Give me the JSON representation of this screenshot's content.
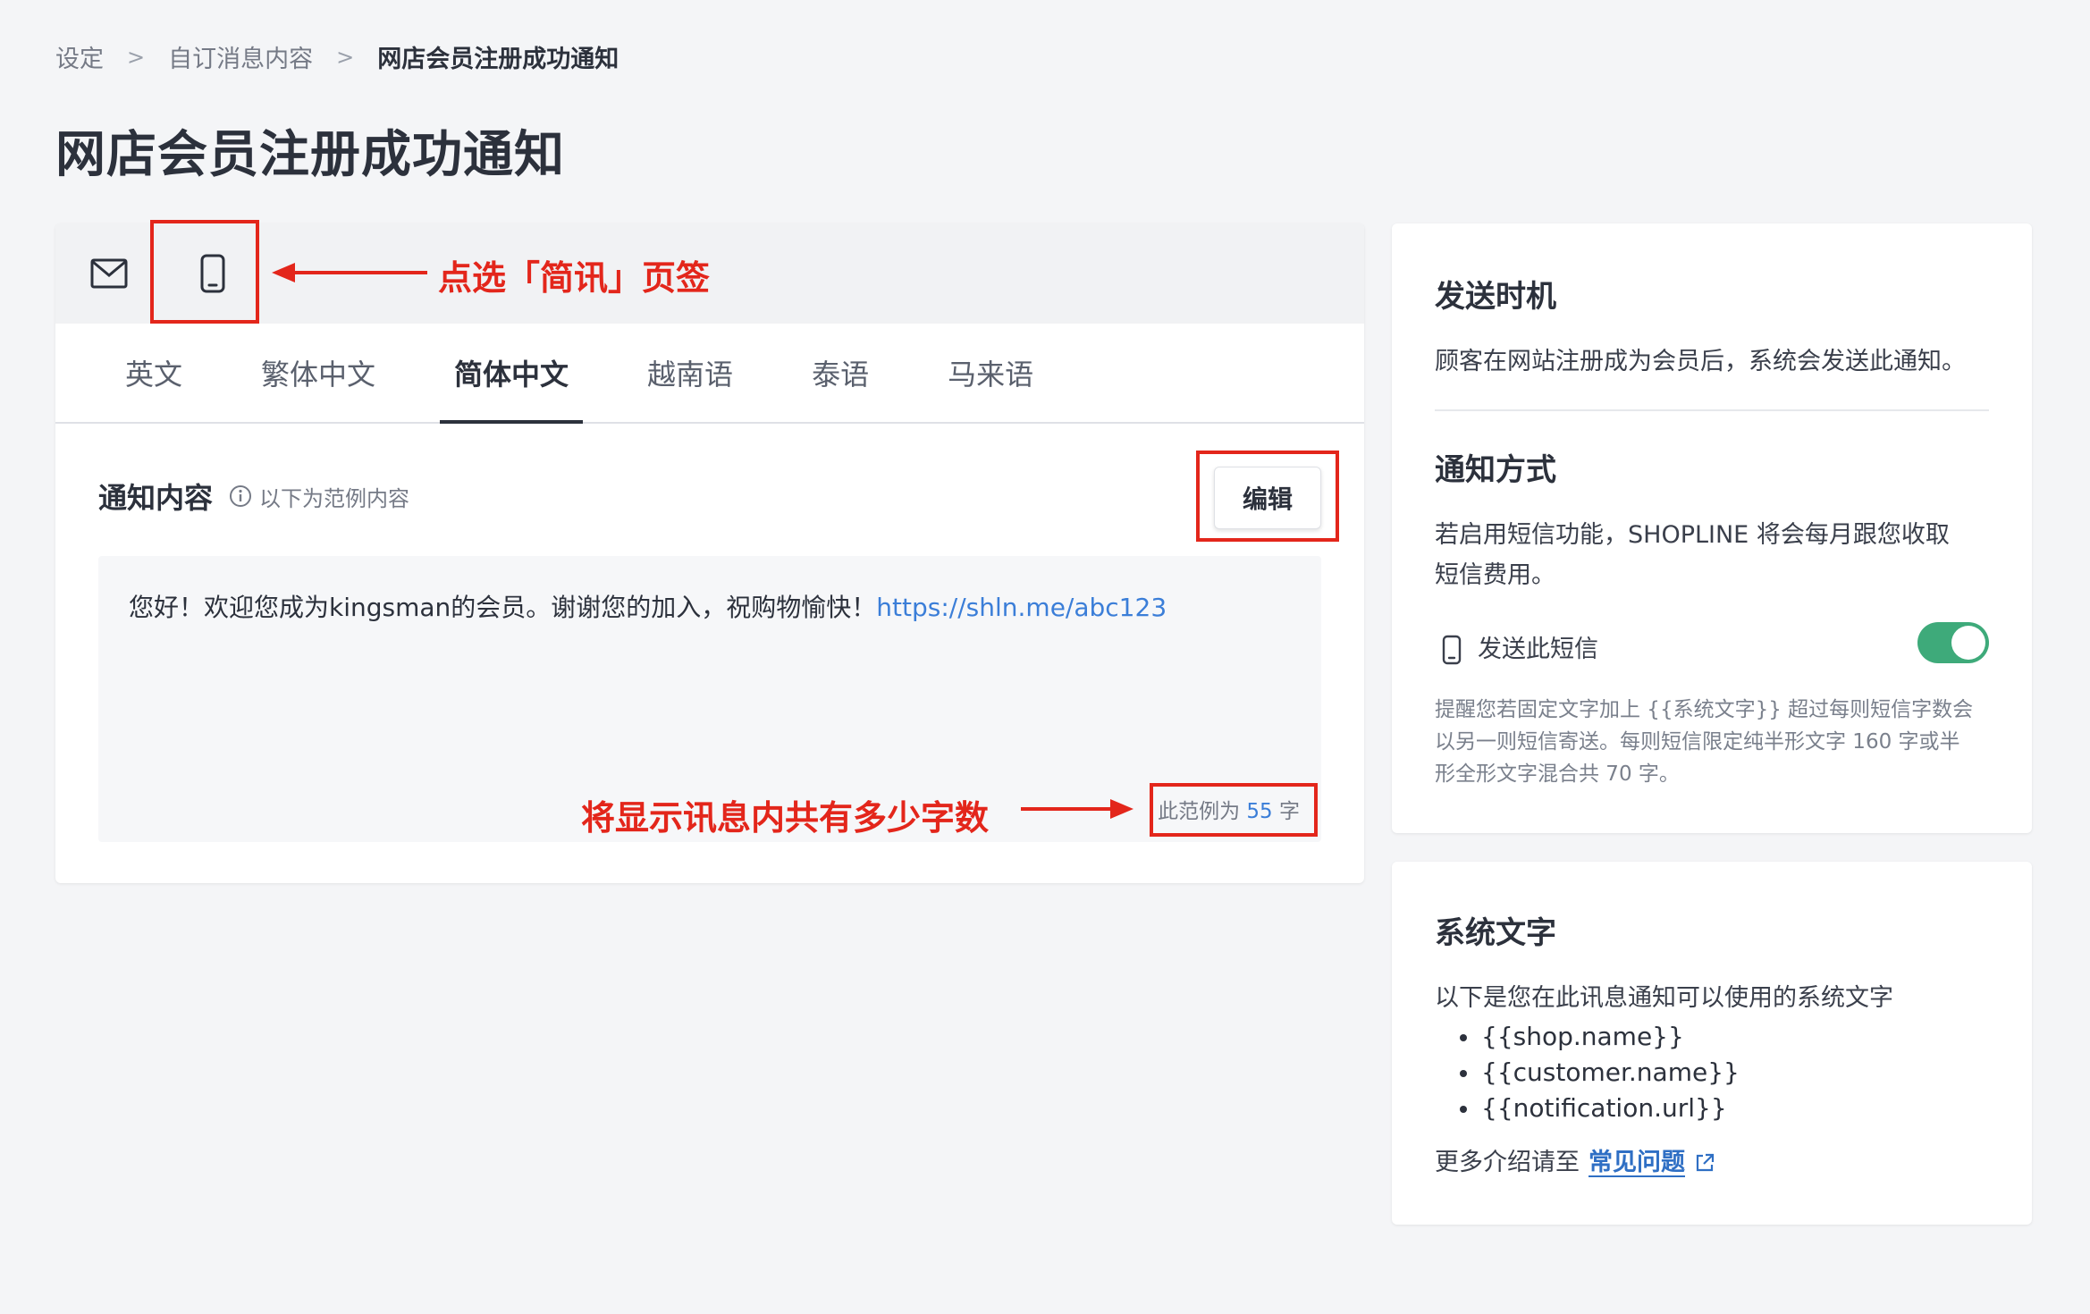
{
  "breadcrumb": {
    "items": [
      "设定",
      "自订消息内容"
    ],
    "separator": ">",
    "current": "网店会员注册成功通知"
  },
  "page_title": "网店会员注册成功通知",
  "channels": [
    {
      "icon": "mail-icon",
      "label": "电邮"
    },
    {
      "icon": "mobile-phone-icon",
      "label": "简讯"
    }
  ],
  "language_tabs": [
    {
      "label": "英文",
      "active": false
    },
    {
      "label": "繁体中文",
      "active": false
    },
    {
      "label": "简体中文",
      "active": true
    },
    {
      "label": "越南语",
      "active": false
    },
    {
      "label": "泰语",
      "active": false
    },
    {
      "label": "马来语",
      "active": false
    }
  ],
  "notification": {
    "label": "通知内容",
    "hint": "以下为范例内容",
    "edit_label": "编辑",
    "message_text": "您好！欢迎您成为kingsman的会员。谢谢您的加入，祝购物愉快！",
    "message_link": "https://shln.me/abc123",
    "count_prefix": "此范例为",
    "count_value": "55",
    "count_suffix": "字"
  },
  "annotations": {
    "tab_hint": "点选「简讯」页签",
    "count_hint": "将显示讯息内共有多少字数"
  },
  "send_timing": {
    "title": "发送时机",
    "text": "顾客在网站注册成为会员后，系统会发送此通知。"
  },
  "notify_method": {
    "title": "通知方式",
    "text_line1": "若启用短信功能，SHOPLINE 将会每月跟您收取",
    "text_line2": "短信费用。",
    "sms_toggle_label": "发送此短信",
    "sms_enabled": true,
    "note_line1": "提醒您若固定文字加上 {{系统文字}} 超过每则短信字数会",
    "note_line2": "以另一则短信寄送。每则短信限定纯半形文字 160 字或半",
    "note_line3": "形全形文字混合共 70 字。"
  },
  "system_text": {
    "title": "系统文字",
    "intro": "以下是您在此讯息通知可以使用的系统文字",
    "variables": [
      "{{shop.name}}",
      "{{customer.name}}",
      "{{notification.url}}"
    ],
    "more_prefix": "更多介绍请至",
    "faq_label": "常见问题"
  },
  "colors": {
    "accent_red": "#e3261b",
    "link_blue": "#3b7ed8",
    "toggle_green": "#3eaa7a"
  }
}
